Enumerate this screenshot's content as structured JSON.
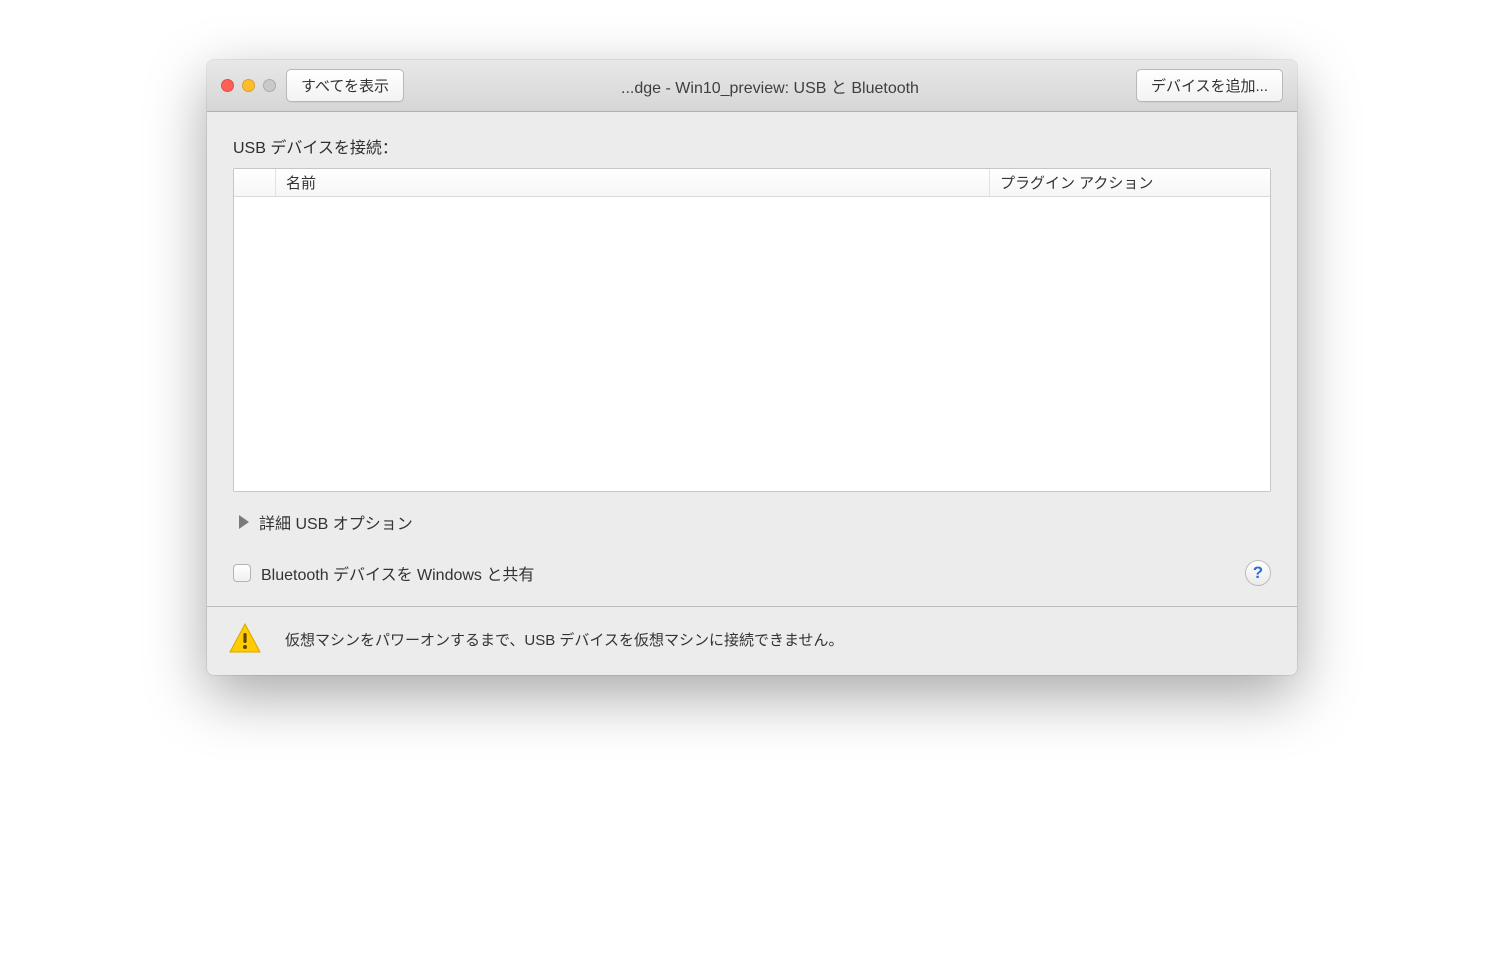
{
  "toolbar": {
    "show_all_label": "すべてを表示",
    "add_device_label": "デバイスを追加..."
  },
  "window": {
    "title": "...dge - Win10_preview: USB と Bluetooth"
  },
  "main": {
    "connect_label": "USB デバイスを接続：",
    "table": {
      "col_name": "名前",
      "col_action": "プラグイン アクション"
    },
    "advanced_label": "詳細 USB オプション",
    "bluetooth_share_label": "Bluetooth デバイスを Windows と共有",
    "help_label": "?"
  },
  "footer": {
    "warning_text": "仮想マシンをパワーオンするまで、USB デバイスを仮想マシンに接続できません。"
  }
}
